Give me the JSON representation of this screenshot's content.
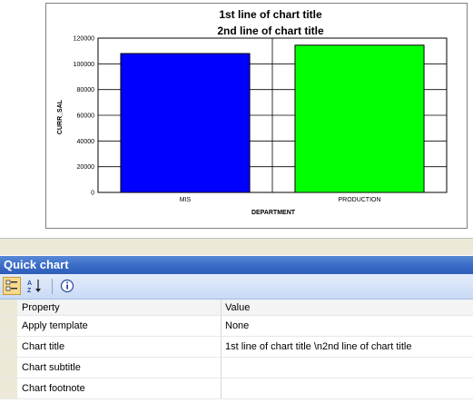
{
  "chart_data": {
    "type": "bar",
    "title": [
      "1st line of chart title",
      "2nd line of chart title"
    ],
    "categories": [
      "MIS",
      "PRODUCTION"
    ],
    "values": [
      108000,
      114500
    ],
    "colors": [
      "#0000ff",
      "#00ff00"
    ],
    "xlabel": "DEPARTMENT",
    "ylabel": "CURR_SAL",
    "ylim": [
      0,
      120000
    ],
    "yticks": [
      0,
      20000,
      40000,
      60000,
      80000,
      100000,
      120000
    ],
    "grid": true
  },
  "panel": {
    "title": "Quick chart",
    "toolbar": {
      "categorized_icon": "categorized-icon",
      "alphabetical_icon": "sort-az-icon",
      "property_pages_icon": "info-icon"
    },
    "columns": {
      "property": "Property",
      "value": "Value"
    },
    "rows": [
      {
        "property": "Apply template",
        "value": "None"
      },
      {
        "property": "Chart title",
        "value": "1st line of chart title \\n2nd line of chart title"
      },
      {
        "property": "Chart subtitle",
        "value": ""
      },
      {
        "property": "Chart footnote",
        "value": ""
      }
    ]
  }
}
